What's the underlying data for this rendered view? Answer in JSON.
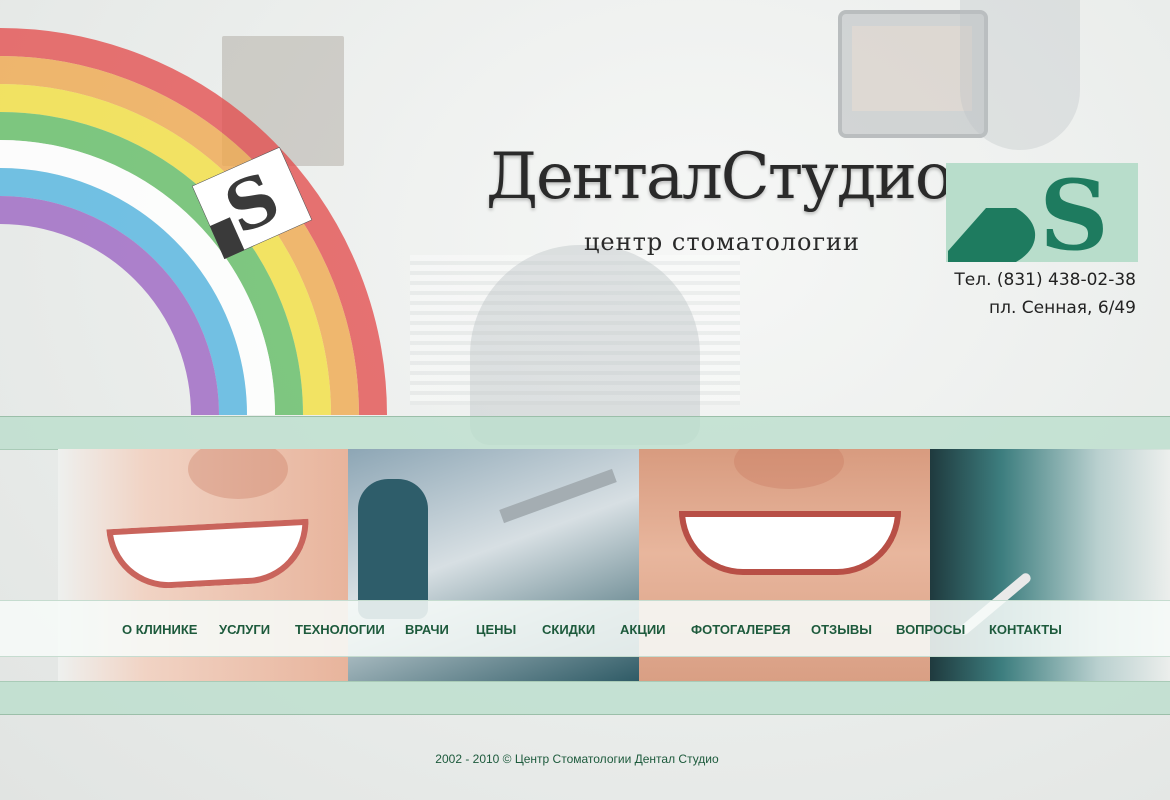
{
  "brand": {
    "title": "ДенталСтудио",
    "subtitle": "центр стоматологии",
    "badge_letters": "DS",
    "accent_color": "#1e7b5f",
    "badge_light_color": "#b8ddcb"
  },
  "contact": {
    "phone": "Тел. (831) 438-02-38",
    "address": "пл. Сенная, 6/49"
  },
  "nav": {
    "items": [
      {
        "label": "О КЛИНИКЕ"
      },
      {
        "label": "УСЛУГИ"
      },
      {
        "label": "ТЕХНОЛОГИИ"
      },
      {
        "label": "ВРАЧИ"
      },
      {
        "label": "ЦЕНЫ"
      },
      {
        "label": "СКИДКИ"
      },
      {
        "label": "АКЦИИ"
      },
      {
        "label": "ФОТОГАЛЕРЕЯ"
      },
      {
        "label": "ОТЗЫВЫ"
      },
      {
        "label": "ВОПРОСЫ"
      },
      {
        "label": "КОНТАКТЫ"
      }
    ],
    "color": "#1d5a3c"
  },
  "footer": {
    "copyright": "2002 - 2010 © Центр Стоматологии Дентал Студио"
  },
  "rainbow_colors": [
    "#e34d4d",
    "#f0a64a",
    "#f3df3c",
    "#5fbb62",
    "#ffffff",
    "#4fb3e0",
    "#9a62c2"
  ]
}
